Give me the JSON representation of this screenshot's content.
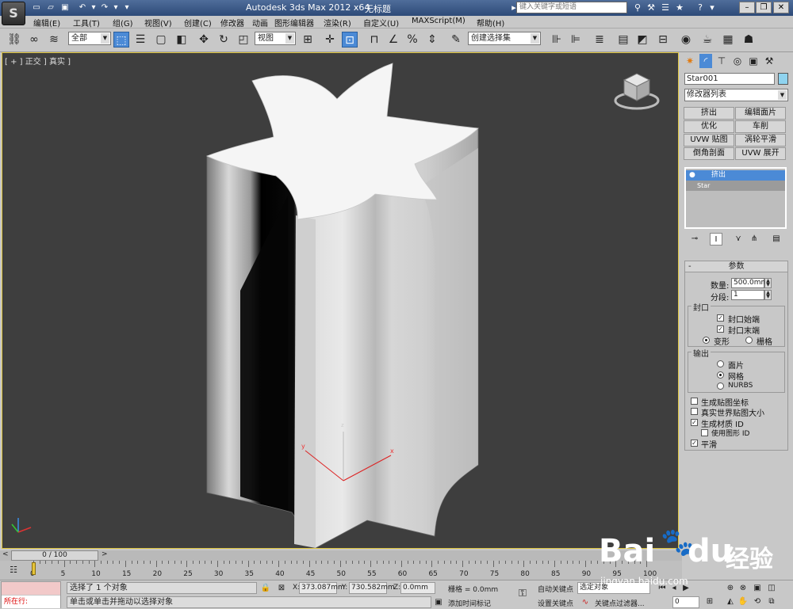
{
  "window": {
    "title": "Autodesk 3ds Max  2012 x64",
    "document": "无标题",
    "search_placeholder": "键入关键字或短语",
    "logo_text": "S"
  },
  "menu": [
    "编辑(E)",
    "工具(T)",
    "组(G)",
    "视图(V)",
    "创建(C)",
    "修改器",
    "动画",
    "图形编辑器",
    "渲染(R)",
    "自定义(U)",
    "MAXScript(M)",
    "帮助(H)"
  ],
  "toolbar": {
    "selection_filter": "全部",
    "ref_coord": "视图",
    "named_selection": "创建选择集"
  },
  "viewport": {
    "label": "[ + ] 正交 ] 真实 ]",
    "axis_x": "x",
    "axis_y": "y",
    "axis_z": "z"
  },
  "command_panel": {
    "object_name": "Star001",
    "object_color": "#8fd3ef",
    "modifier_list": "修改器列表",
    "modifier_buttons": [
      "挤出",
      "编辑面片",
      "优化",
      "车削",
      "UVW 贴图",
      "涡轮平滑",
      "倒角剖面",
      "UVW 展开"
    ],
    "stack": [
      "挤出",
      "Star"
    ],
    "params": {
      "title": "参数",
      "amount_label": "数量:",
      "amount_value": "500.0mm",
      "segments_label": "分段:",
      "segments_value": "1",
      "capping_title": "封口",
      "cap_start": "封口始端",
      "cap_end": "封口末端",
      "morph": "变形",
      "grid": "栅格",
      "output_title": "输出",
      "patch": "面片",
      "mesh": "网格",
      "nurbs": "NURBS",
      "gen_mapping": "生成贴图坐标",
      "real_world": "真实世界贴图大小",
      "gen_material": "生成材质 ID",
      "use_shape_ids": "使用图形 ID",
      "smooth": "平滑"
    }
  },
  "timeline": {
    "frame": "0 / 100",
    "ticks": [
      "0",
      "5",
      "10",
      "15",
      "20",
      "25",
      "30",
      "35",
      "40",
      "45",
      "50",
      "55",
      "60",
      "65",
      "70",
      "75",
      "80",
      "85",
      "90",
      "95",
      "100"
    ]
  },
  "status": {
    "maxscript_prompt": "所在行:",
    "selected": "选择了 1 个对象",
    "hint": "单击或单击并拖动以选择对象",
    "x_label": "X:",
    "x_value": "373.087mm",
    "y_label": "Y:",
    "y_value": "730.582mm",
    "z_label": "Z:",
    "z_value": "0.0mm",
    "grid": "栅格 = 0.0mm",
    "add_time_tag": "添加时间标记",
    "auto_key": "自动关键点",
    "set_key": "设置关键点",
    "selected_obj": "选定对象",
    "key_filters": "关键点过滤器...",
    "frame_value": "0"
  },
  "watermark": {
    "brand": "Bai",
    "brand2": "du",
    "cn": "经验",
    "url": "jingyan.baidu.com"
  }
}
